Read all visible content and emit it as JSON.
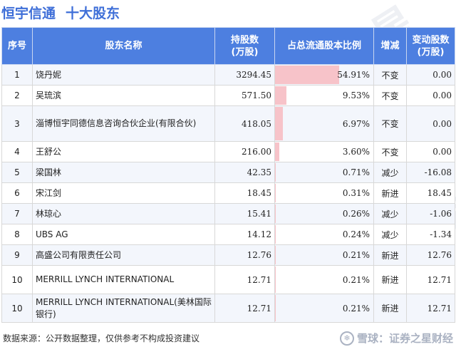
{
  "header": {
    "title": "恒宇信通",
    "subtitle": "十大股东"
  },
  "table": {
    "columns": [
      "序号",
      "股东名称",
      "持股数\n(万股)",
      "占总流通股本比例",
      "增减",
      "变动股数\n(万股)"
    ],
    "rows": [
      {
        "idx": "1",
        "name": "饶丹妮",
        "shares": "3294.45",
        "pct_text": "54.91%",
        "pct": 54.91,
        "change": "不变",
        "status": "same",
        "delta": "0.00"
      },
      {
        "idx": "2",
        "name": "吴琉滨",
        "shares": "571.50",
        "pct_text": "9.53%",
        "pct": 9.53,
        "change": "不变",
        "status": "same",
        "delta": "0.00"
      },
      {
        "idx": "3",
        "name": "淄博恒宇同德信息咨询合伙企业(有限合伙)",
        "shares": "418.05",
        "pct_text": "6.97%",
        "pct": 6.97,
        "change": "不变",
        "status": "same",
        "delta": "0.00"
      },
      {
        "idx": "4",
        "name": "王舒公",
        "shares": "216.00",
        "pct_text": "3.60%",
        "pct": 3.6,
        "change": "不变",
        "status": "same",
        "delta": "0.00"
      },
      {
        "idx": "5",
        "name": "梁国林",
        "shares": "42.35",
        "pct_text": "0.71%",
        "pct": 0.71,
        "change": "减少",
        "status": "down",
        "delta": "-16.08"
      },
      {
        "idx": "6",
        "name": "宋江剑",
        "shares": "18.45",
        "pct_text": "0.31%",
        "pct": 0.31,
        "change": "新进",
        "status": "new",
        "delta": "18.45"
      },
      {
        "idx": "7",
        "name": "林琼心",
        "shares": "15.41",
        "pct_text": "0.26%",
        "pct": 0.26,
        "change": "减少",
        "status": "down",
        "delta": "-1.06"
      },
      {
        "idx": "8",
        "name": "UBS AG",
        "shares": "14.12",
        "pct_text": "0.24%",
        "pct": 0.24,
        "change": "减少",
        "status": "down",
        "delta": "-1.34"
      },
      {
        "idx": "9",
        "name": "高盛公司有限责任公司",
        "shares": "12.76",
        "pct_text": "0.21%",
        "pct": 0.21,
        "change": "新进",
        "status": "new",
        "delta": "12.76"
      },
      {
        "idx": "10",
        "name": "MERRILL LYNCH INTERNATIONAL",
        "shares": "12.71",
        "pct_text": "0.21%",
        "pct": 0.21,
        "change": "新进",
        "status": "new",
        "delta": "12.71"
      },
      {
        "idx": "10",
        "name": "MERRILL LYNCH INTERNATIONAL(美林国际银行)",
        "shares": "12.71",
        "pct_text": "0.21%",
        "pct": 0.21,
        "change": "新进",
        "status": "new",
        "delta": "12.71"
      }
    ]
  },
  "colors": {
    "header_bg": "#4d7fe0",
    "title": "#3f6fd8",
    "bar": "#f7c3c9",
    "down": "#2a9a3c",
    "new": "#e02b2b"
  },
  "watermark": "证券之星",
  "footer": {
    "source": "数据来源：公开数据整理，仅供参考不构成投资建议",
    "brand": "雪球：证券之星财经",
    "brand_icon": "snowball-logo-icon"
  }
}
